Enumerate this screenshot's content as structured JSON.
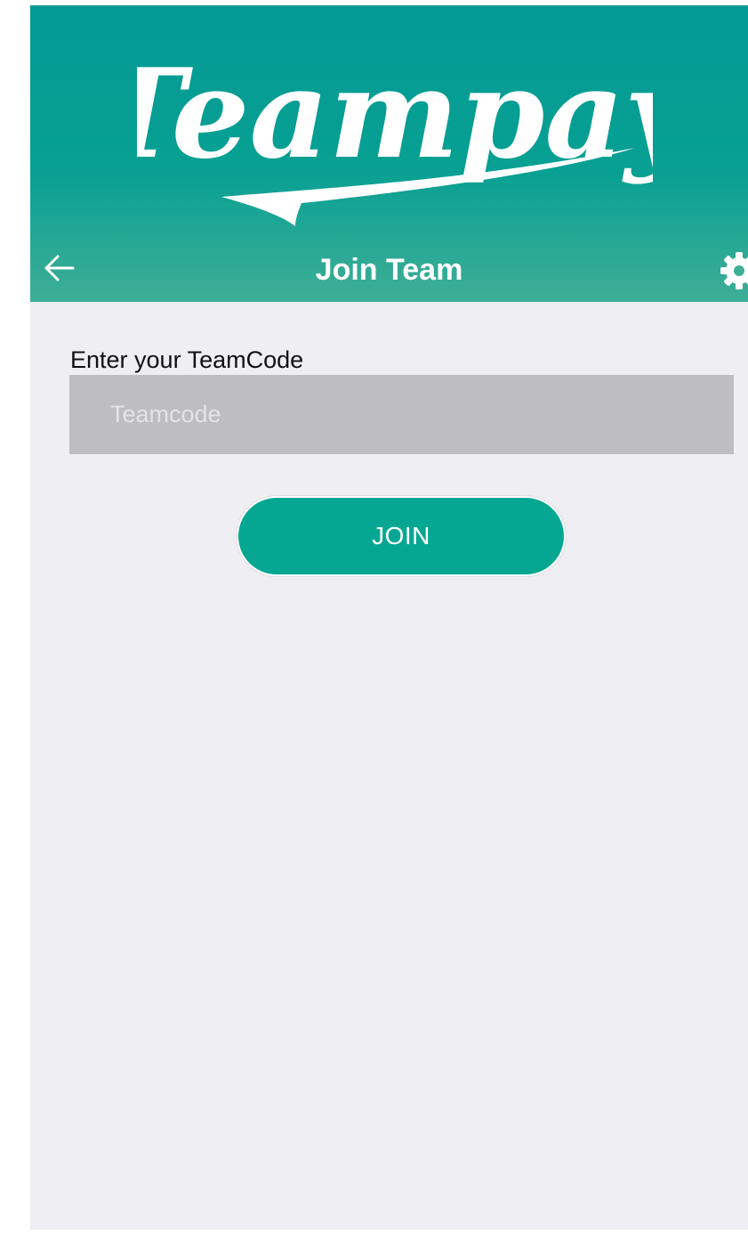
{
  "brand": {
    "logo_text": "Teampay",
    "header_color_top": "#039a94",
    "header_color_bottom": "#3fae96",
    "accent": "#05a792"
  },
  "navbar": {
    "title": "Join Team",
    "back_icon": "arrow-left-icon",
    "settings_icon": "gear-icon"
  },
  "form": {
    "label": "Enter your TeamCode",
    "input_value": "",
    "input_placeholder": "Teamcode",
    "join_label": "JOIN"
  }
}
